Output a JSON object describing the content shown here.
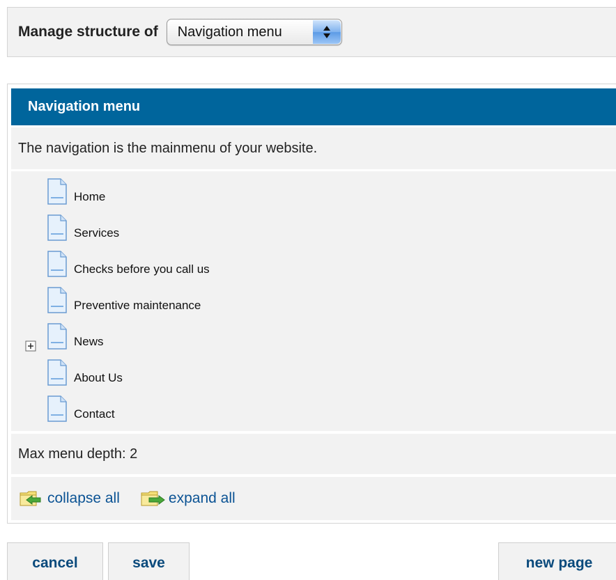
{
  "manage": {
    "label": "Manage structure of",
    "selected": "Navigation menu"
  },
  "panel": {
    "title": "Navigation menu",
    "description": "The navigation is the mainmenu of your website.",
    "items": [
      {
        "label": "Home",
        "expandable": false
      },
      {
        "label": "Services",
        "expandable": false
      },
      {
        "label": "Checks before you call us",
        "expandable": true
      },
      {
        "label": "Preventive maintenance",
        "expandable": false
      },
      {
        "label": "News",
        "expandable": false
      },
      {
        "label": "About Us",
        "expandable": false
      },
      {
        "label": "Contact",
        "expandable": false
      }
    ],
    "depth": "Max menu depth: 2",
    "collapse_all": "collapse all",
    "expand_all": "expand all"
  },
  "buttons": {
    "cancel": "cancel",
    "save": "save",
    "new_page": "new page"
  },
  "colors": {
    "header_bg": "#00659c",
    "panel_bg": "#f2f2f2",
    "link": "#0b5394",
    "button_text": "#0a4a7c"
  },
  "icons": {
    "tree_item": "page-icon",
    "expander": "plus-box-icon",
    "collapse": "folder-arrow-left-icon",
    "expand": "folder-arrow-right-icon"
  }
}
